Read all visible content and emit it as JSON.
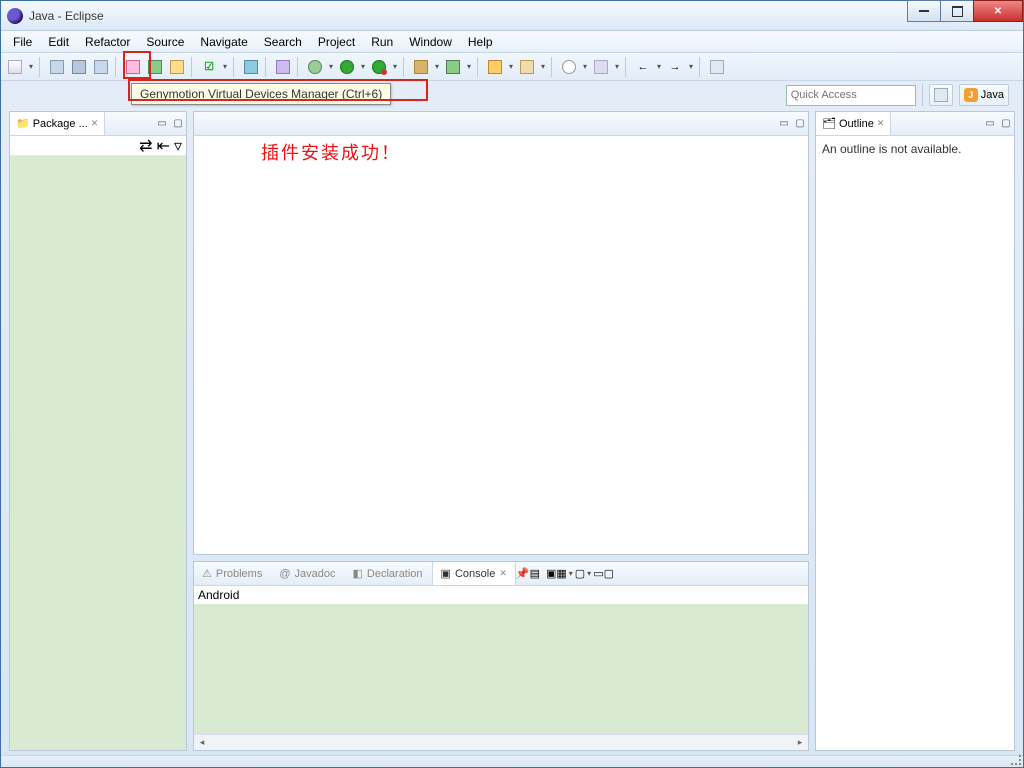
{
  "window": {
    "title": "Java - Eclipse"
  },
  "menu": [
    "File",
    "Edit",
    "Refactor",
    "Source",
    "Navigate",
    "Search",
    "Project",
    "Run",
    "Window",
    "Help"
  ],
  "tooltip": "Genymotion Virtual Devices Manager (Ctrl+6)",
  "quick_access_placeholder": "Quick Access",
  "perspective": {
    "open_label": "",
    "java_label": "Java"
  },
  "left_view": {
    "title": "Package ...",
    "tool_icons": [
      "link-icon",
      "collapse-icon",
      "menu-icon"
    ]
  },
  "editor": {},
  "outline": {
    "title": "Outline",
    "body": "An outline is not available."
  },
  "bottom": {
    "tabs": [
      {
        "label": "Problems",
        "active": false
      },
      {
        "label": "Javadoc",
        "active": false
      },
      {
        "label": "Declaration",
        "active": false
      },
      {
        "label": "Console",
        "active": true
      }
    ],
    "console_title": "Android"
  },
  "annotation": "插件安装成功！"
}
